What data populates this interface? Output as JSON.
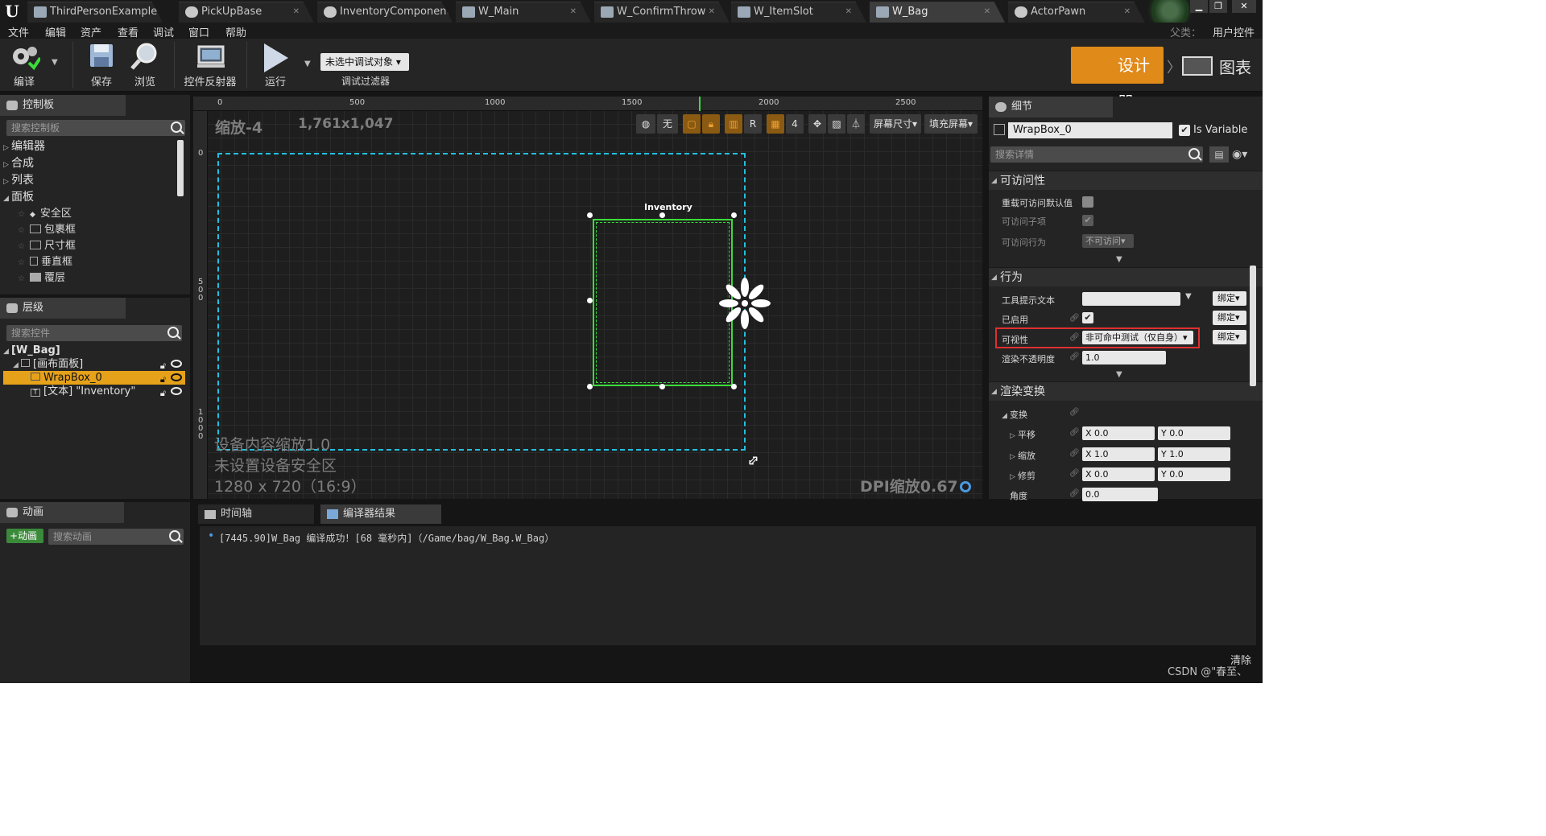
{
  "tabs": [
    {
      "label": "ThirdPersonExampleMa",
      "active": false
    },
    {
      "label": "PickUpBase",
      "active": false
    },
    {
      "label": "InventoryComponent",
      "active": false
    },
    {
      "label": "W_Main",
      "active": false
    },
    {
      "label": "W_ConfirmThrow",
      "active": false
    },
    {
      "label": "W_ItemSlot",
      "active": false
    },
    {
      "label": "W_Bag",
      "active": true
    },
    {
      "label": "ActorPawn",
      "active": false
    }
  ],
  "menu": [
    "文件",
    "编辑",
    "资产",
    "查看",
    "调试",
    "窗口",
    "帮助"
  ],
  "parent_class": {
    "label": "父类：",
    "value": "用户控件"
  },
  "toolbar": {
    "compile": "编译",
    "save": "保存",
    "browse": "浏览",
    "widget_reflector": "控件反射器",
    "play": "运行",
    "debug_object": "未选中调试对象",
    "debug_filter": "调试过滤器",
    "designer": "设计器",
    "graph": "图表"
  },
  "palette": {
    "title": "控制板",
    "search_placeholder": "搜索控制板",
    "categories": [
      "编辑器",
      "合成",
      "列表",
      "面板"
    ],
    "items": [
      "安全区",
      "包裹框",
      "尺寸框",
      "垂直框",
      "覆层"
    ]
  },
  "hierarchy": {
    "title": "层级",
    "search_placeholder": "搜索控件",
    "root": "[W_Bag]",
    "rows": [
      {
        "label": "[画布面板]",
        "selected": false
      },
      {
        "label": "WrapBox_0",
        "selected": true
      },
      {
        "label": "[文本] \"Inventory\"",
        "selected": false
      }
    ]
  },
  "canvas": {
    "zoom": "缩放-4",
    "resolution": "1,761x1,047",
    "ruler_top": [
      "0",
      "500",
      "1000",
      "1500",
      "2000",
      "2500"
    ],
    "ruler_left": [
      "0",
      "500",
      "1000"
    ],
    "toolbar": {
      "none": "无",
      "r": "R",
      "grid": "4",
      "screen_size": "屏幕尺寸",
      "fill_screen": "填充屏幕"
    },
    "inventory_label": "Inventory",
    "overlay": [
      "设备内容缩放1.0",
      "未设置设备安全区",
      "1280 x 720（16:9）"
    ],
    "dpi": "DPI缩放0.67"
  },
  "details": {
    "title": "细节",
    "name": "WrapBox_0",
    "is_variable_label": "Is Variable",
    "is_variable": true,
    "search_placeholder": "搜索详情",
    "sections": {
      "accessibility": "可访问性",
      "behavior": "行为",
      "render_transform": "渲染变换"
    },
    "accessibility": {
      "override": "重载可访问默认值",
      "can_children": "可访问子项",
      "behavior_label": "可访问行为",
      "behavior_value": "不可访问"
    },
    "behavior": {
      "tooltip": "工具提示文本",
      "enabled": "已启用",
      "visibility": "可视性",
      "visibility_value": "非可命中测试（仅自身）",
      "opacity": "渲染不透明度",
      "opacity_value": "1.0",
      "bind": "绑定"
    },
    "transform": {
      "transform": "变换",
      "translation": "平移",
      "scale": "缩放",
      "shear": "修剪",
      "angle": "角度",
      "translation_x": "X 0.0",
      "translation_y": "Y 0.0",
      "scale_x": "X 1.0",
      "scale_y": "Y 1.0",
      "shear_x": "X 0.0",
      "shear_y": "Y 0.0",
      "angle_value": "0.0"
    }
  },
  "animations": {
    "title": "动画",
    "add": "动画",
    "search_placeholder": "搜索动画"
  },
  "bottom_tabs": [
    "时间轴",
    "编译器结果"
  ],
  "log": "[7445.90]W_Bag 编译成功！[68 毫秒内]（/Game/bag/W_Bag.W_Bag）",
  "clear": "清除",
  "watermark": "CSDN @\"春至、"
}
